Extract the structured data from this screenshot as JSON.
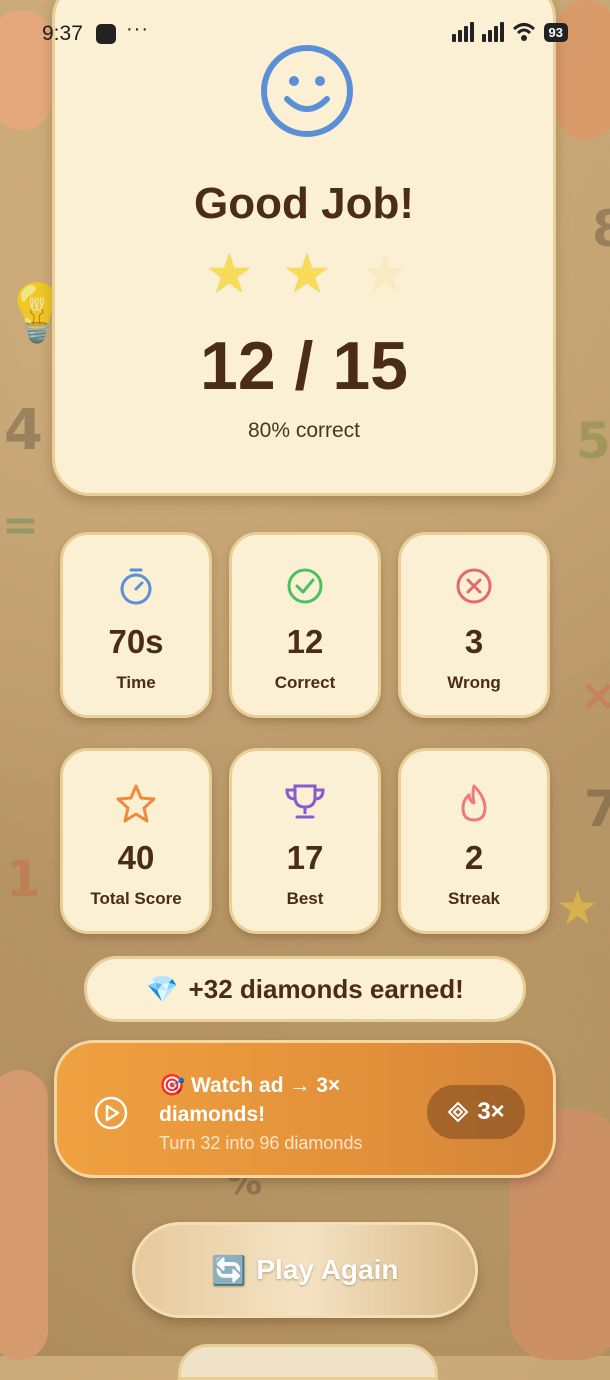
{
  "status_bar": {
    "time": "9:37",
    "more": "···",
    "battery": "93"
  },
  "result": {
    "title": "Good Job!",
    "stars_earned": 2,
    "stars_total": 3,
    "score": "12 / 15",
    "percent_label": "80% correct"
  },
  "stats": [
    {
      "value": "70s",
      "label": "Time",
      "icon": "stopwatch-icon",
      "color": "#5b8fd6"
    },
    {
      "value": "12",
      "label": "Correct",
      "icon": "check-circle-icon",
      "color": "#4cbf62"
    },
    {
      "value": "3",
      "label": "Wrong",
      "icon": "x-circle-icon",
      "color": "#e36a6a"
    },
    {
      "value": "40",
      "label": "Total Score",
      "icon": "star-icon",
      "color": "#f08a3a"
    },
    {
      "value": "17",
      "label": "Best",
      "icon": "trophy-icon",
      "color": "#8a5ad2"
    },
    {
      "value": "2",
      "label": "Streak",
      "icon": "flame-icon",
      "color": "#ee7a7a"
    }
  ],
  "diamonds": {
    "emoji": "💎",
    "text": "+32 diamonds earned!"
  },
  "watch_ad": {
    "title": "🎯 Watch ad → 3× diamonds!",
    "subtitle": "Turn 32 into 96 diamonds",
    "multiplier": "3×"
  },
  "play_again": {
    "emoji": "🔄",
    "label": "Play Again"
  },
  "colors": {
    "card_bg": "#fbf0d3",
    "text_dark": "#4a2c18",
    "accent_orange": "#e3913a"
  }
}
